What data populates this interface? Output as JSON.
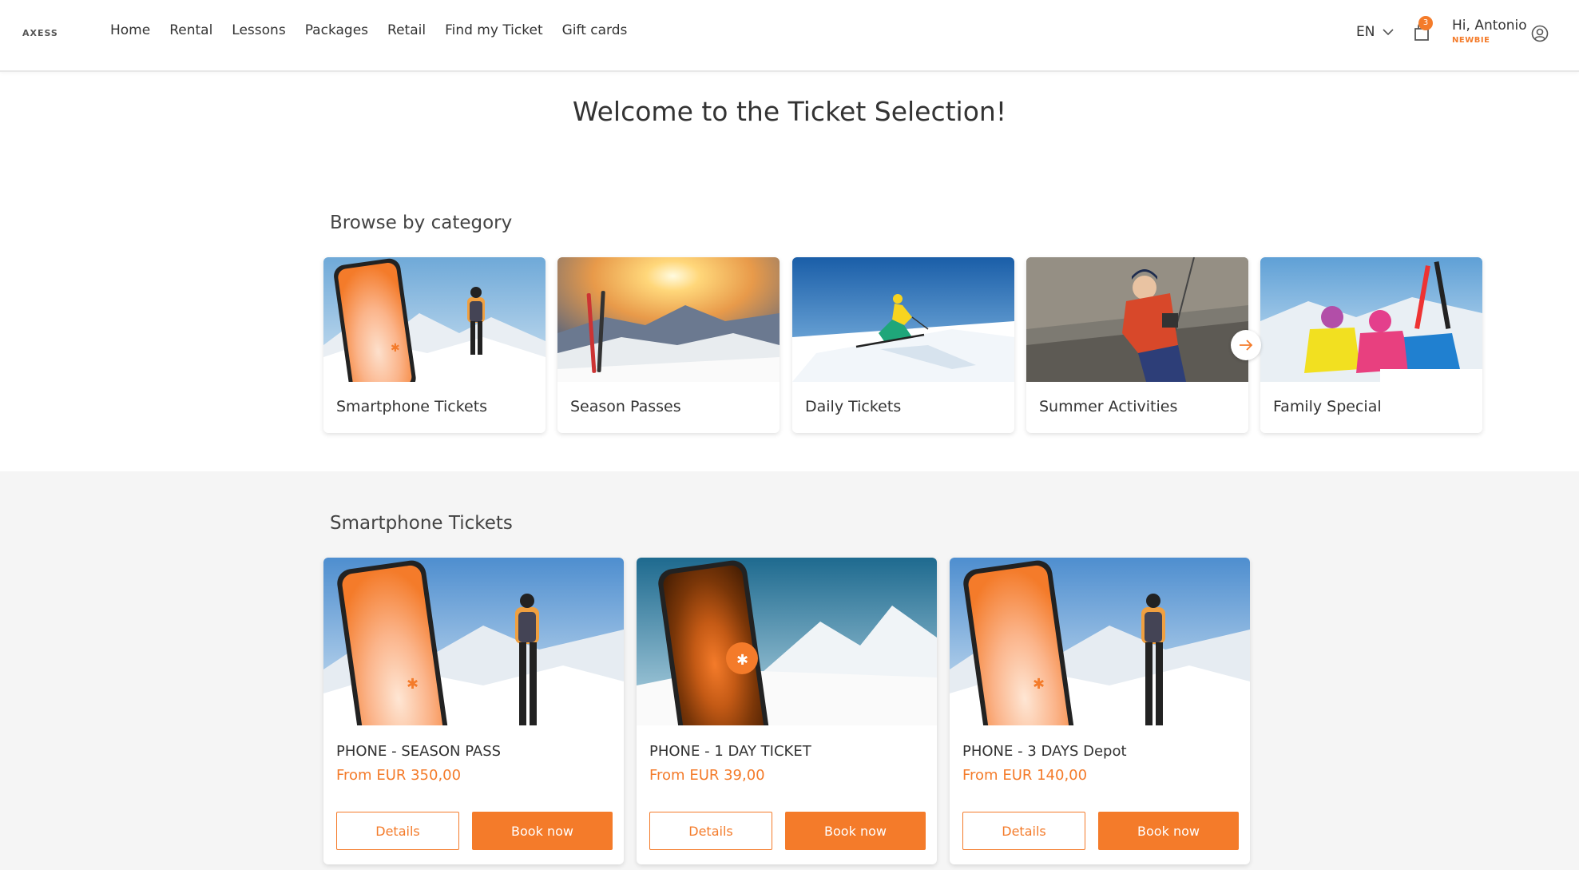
{
  "header": {
    "logo_text": "AXESS",
    "nav": [
      "Home",
      "Rental",
      "Lessons",
      "Packages",
      "Retail",
      "Find my Ticket",
      "Gift cards"
    ],
    "language": "EN",
    "cart_count": "3",
    "greeting": "Hi, Antonio",
    "user_level": "NEWBIE"
  },
  "page_title": "Welcome to the Ticket Selection!",
  "browse": {
    "title": "Browse by category",
    "categories": [
      {
        "label": "Smartphone Tickets"
      },
      {
        "label": "Season Passes"
      },
      {
        "label": "Daily Tickets"
      },
      {
        "label": "Summer Activities"
      },
      {
        "label": "Family Special"
      }
    ]
  },
  "products_section": {
    "title": "Smartphone Tickets",
    "products": [
      {
        "name": "PHONE - SEASON PASS",
        "price": "From EUR 350,00",
        "details_label": "Details",
        "book_label": "Book now"
      },
      {
        "name": "PHONE - 1 DAY TICKET",
        "price": "From EUR 39,00",
        "details_label": "Details",
        "book_label": "Book now"
      },
      {
        "name": "PHONE - 3 DAYS Depot",
        "price": "From EUR 140,00",
        "details_label": "Details",
        "book_label": "Book now"
      }
    ]
  },
  "colors": {
    "accent": "#f47b2a",
    "text": "#333333",
    "section_bg": "#f5f5f5"
  }
}
